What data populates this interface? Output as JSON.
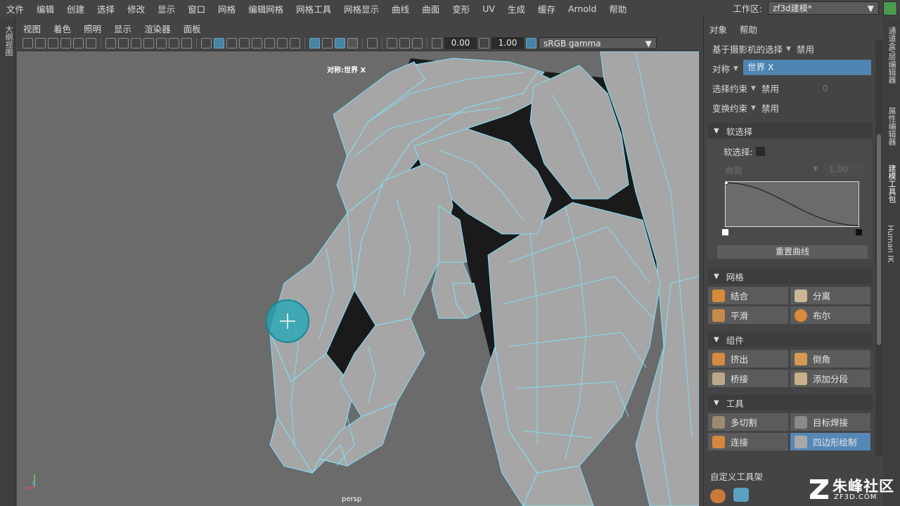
{
  "menubar": {
    "items": [
      "文件",
      "编辑",
      "创建",
      "选择",
      "修改",
      "显示",
      "窗口",
      "网格",
      "编辑网格",
      "网格工具",
      "网格显示",
      "曲线",
      "曲面",
      "变形",
      "UV",
      "生成",
      "缓存",
      "Arnold",
      "帮助"
    ],
    "workspace_label": "工作区:",
    "workspace_value": "zf3d建模*"
  },
  "leftstrip": {
    "label": "大纲视图"
  },
  "viewport": {
    "menu": [
      "视图",
      "着色",
      "照明",
      "显示",
      "渲染器",
      "面板"
    ],
    "num1": "0.00",
    "num2": "1.00",
    "colorspace": "sRGB gamma",
    "symmetry_label": "对称:世界 X",
    "camera_label": "persp"
  },
  "rightpanel": {
    "menu": [
      "对象",
      "帮助"
    ],
    "rows": {
      "camera_select": "基于摄影机的选择",
      "camera_select_val": "禁用",
      "symmetry": "对称",
      "symmetry_val": "世界 X",
      "select_constraint": "选择约束",
      "select_constraint_val": "禁用",
      "select_constraint_num": "0",
      "transform_constraint": "变换约束",
      "transform_constraint_val": "禁用"
    },
    "soft": {
      "title": "软选择",
      "label": "软选择:",
      "falloff": "曲面",
      "falloff_num": "1.00",
      "reset": "重置曲线"
    },
    "mesh": {
      "title": "网格",
      "b1": "结合",
      "b2": "分离",
      "b3": "平滑",
      "b4": "布尔"
    },
    "component": {
      "title": "组件",
      "b1": "挤出",
      "b2": "倒角",
      "b3": "桥接",
      "b4": "添加分段"
    },
    "tools": {
      "title": "工具",
      "b1": "多切割",
      "b2": "目标焊接",
      "b3": "连接",
      "b4": "四边形绘制"
    },
    "shelf_title": "自定义工具架"
  },
  "rightstrip": {
    "labels": [
      "通道盒/层编辑器",
      "属性编辑器",
      "建模工具包",
      "Human IK"
    ]
  },
  "watermark": {
    "main": "朱峰社区",
    "sub": "ZF3D.COM"
  },
  "colors": {
    "wire": "#7fe3ff",
    "mesh": "#a9a9a9",
    "accent": "#4e84b1"
  }
}
